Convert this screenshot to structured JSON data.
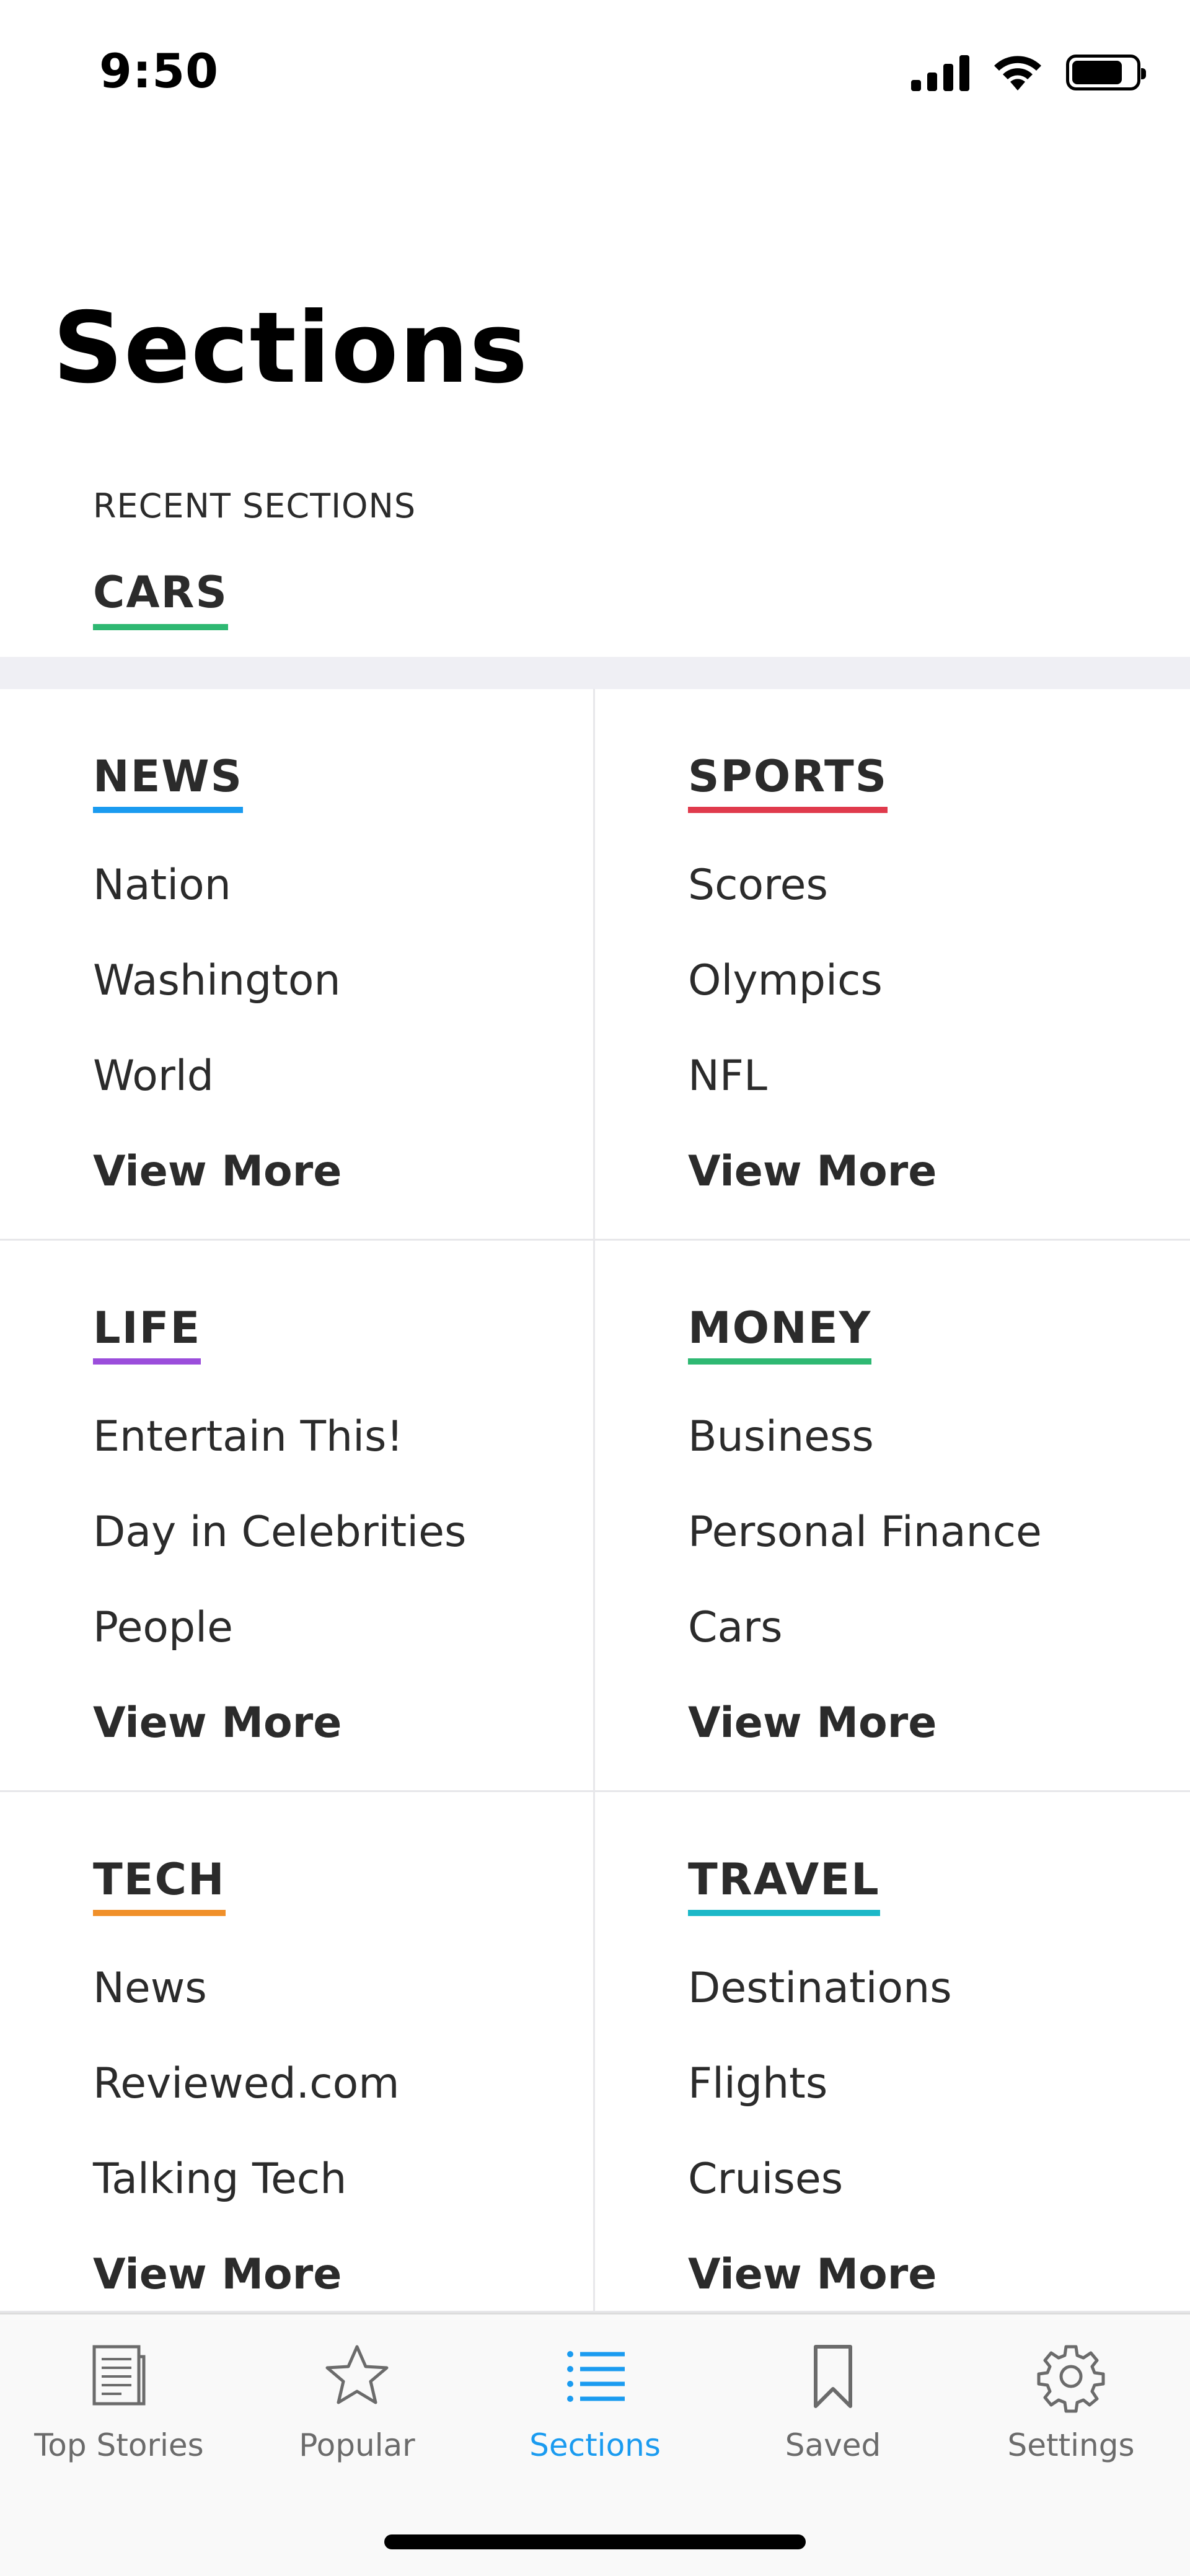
{
  "status": {
    "time": "9:50"
  },
  "header": {
    "title": "Sections",
    "recent_label": "RECENT SECTIONS",
    "recent_items": [
      "CARS"
    ]
  },
  "colors": {
    "cars": "#2eb872",
    "news": "#1a9bf0",
    "sports": "#e03a4c",
    "life": "#9b4ddb",
    "money": "#2eb872",
    "tech": "#f0902a",
    "travel": "#1cb8c8",
    "tab_active": "#1a9bf0"
  },
  "sections": [
    {
      "title": "NEWS",
      "color": "#1a9bf0",
      "items": [
        "Nation",
        "Washington",
        "World"
      ],
      "more": "View More"
    },
    {
      "title": "SPORTS",
      "color": "#e03a4c",
      "items": [
        "Scores",
        "Olympics",
        "NFL"
      ],
      "more": "View More"
    },
    {
      "title": "LIFE",
      "color": "#9b4ddb",
      "items": [
        "Entertain This!",
        "Day in Celebrities",
        "People"
      ],
      "more": "View More"
    },
    {
      "title": "MONEY",
      "color": "#2eb872",
      "items": [
        "Business",
        "Personal Finance",
        "Cars"
      ],
      "more": "View More"
    },
    {
      "title": "TECH",
      "color": "#f0902a",
      "items": [
        "News",
        "Reviewed.com",
        "Talking Tech"
      ],
      "more": "View More"
    },
    {
      "title": "TRAVEL",
      "color": "#1cb8c8",
      "items": [
        "Destinations",
        "Flights",
        "Cruises"
      ],
      "more": "View More"
    }
  ],
  "tabs": [
    {
      "label": "Top Stories",
      "icon": "newspaper-icon"
    },
    {
      "label": "Popular",
      "icon": "star-icon"
    },
    {
      "label": "Sections",
      "icon": "list-icon",
      "active": true
    },
    {
      "label": "Saved",
      "icon": "bookmark-icon"
    },
    {
      "label": "Settings",
      "icon": "gear-icon"
    }
  ]
}
